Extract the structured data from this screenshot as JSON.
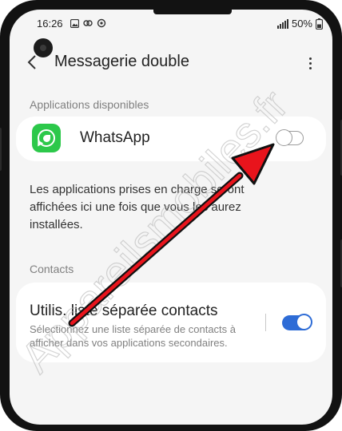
{
  "status_bar": {
    "time": "16:26",
    "battery": "50%"
  },
  "header": {
    "title": "Messagerie double"
  },
  "sections": {
    "apps_header": "Applications disponibles",
    "contacts_header": "Contacts"
  },
  "apps": [
    {
      "name": "WhatsApp",
      "icon": "whatsapp-icon",
      "enabled": false
    }
  ],
  "info_text": "Les applications prises en charge seront affichées ici une fois que vous les aurez installées.",
  "contacts_setting": {
    "title": "Utilis. liste séparée contacts",
    "description": "Sélectionnez une liste séparée de contacts à afficher dans vos applications secondaires.",
    "enabled": true
  },
  "watermark": "Appareilsmobiles.fr",
  "colors": {
    "screen_bg": "#f5f5f5",
    "card_bg": "#ffffff",
    "toggle_on": "#2e6cd6",
    "whatsapp_green": "#2cc84a",
    "arrow_red": "#e8141c"
  }
}
